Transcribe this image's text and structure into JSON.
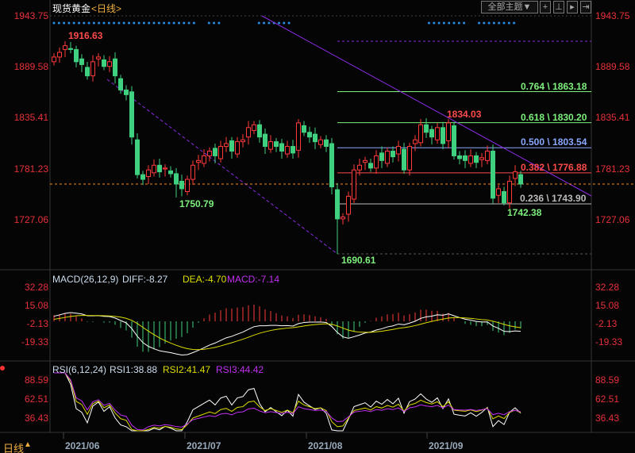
{
  "header": {
    "title": "现货黄金",
    "period": "<日线>",
    "theme_button": "全部主题▼"
  },
  "price_axis": [
    "1943.75",
    "1889.58",
    "1835.41",
    "1781.23",
    "1727.06"
  ],
  "price_labels": {
    "high1": "1916.63",
    "low1": "1750.79",
    "low2": "1690.61",
    "high2": "1834.03",
    "low3": "1742.38"
  },
  "fib": [
    {
      "label": "0.764 \\ 1863.18",
      "price": 1863.18,
      "color": "#7df07d"
    },
    {
      "label": "0.618 \\ 1830.20",
      "price": 1830.2,
      "color": "#7df07d"
    },
    {
      "label": "0.500 \\ 1803.54",
      "price": 1803.54,
      "color": "#8aa8ff"
    },
    {
      "label": "0.382 \\ 1776.88",
      "price": 1776.88,
      "color": "#ff4a4a"
    },
    {
      "label": "0.236 \\ 1743.90",
      "price": 1743.9,
      "color": "#bbbbbb"
    }
  ],
  "macd": {
    "title": "MACD(26,12,9)",
    "diff": "DIFF:-8.27",
    "dea": "DEA:-4.70",
    "macd": "MACD:-7.14",
    "axis": [
      "32.28",
      "15.08",
      "-2.13",
      "-19.33"
    ]
  },
  "rsi": {
    "title": "RSI(6,12,24)",
    "rsi1": "RSI1:38.88",
    "rsi2": "RSI2:41.47",
    "rsi3": "RSI3:44.42",
    "axis": [
      "88.59",
      "62.51",
      "36.43"
    ]
  },
  "footer": {
    "period": "日线",
    "dates": [
      "2021/06",
      "2021/07",
      "2021/08",
      "2021/09"
    ]
  },
  "colors": {
    "up": "#ff3b3b",
    "down": "#3fd17f",
    "axis": "#e8303a"
  },
  "chart_data": {
    "type": "candlestick",
    "ylim": [
      1690,
      1943.75
    ],
    "closes": [
      1900,
      1905,
      1912,
      1908,
      1895,
      1892,
      1880,
      1895,
      1900,
      1890,
      1895,
      1880,
      1865,
      1860,
      1815,
      1775,
      1770,
      1780,
      1785,
      1778,
      1782,
      1776,
      1765,
      1760,
      1770,
      1785,
      1790,
      1795,
      1800,
      1795,
      1805,
      1808,
      1800,
      1810,
      1812,
      1825,
      1828,
      1815,
      1805,
      1810,
      1805,
      1800,
      1805,
      1798,
      1830,
      1820,
      1815,
      1810,
      1812,
      1805,
      1762,
      1728,
      1730,
      1752,
      1780,
      1785,
      1790,
      1782,
      1795,
      1790,
      1800,
      1794,
      1805,
      1780,
      1805,
      1812,
      1828,
      1820,
      1815,
      1825,
      1808,
      1830,
      1795,
      1792,
      1790,
      1795,
      1788,
      1793,
      1800,
      1750,
      1760,
      1745,
      1768,
      1778,
      1765
    ],
    "last_price": 1765
  }
}
